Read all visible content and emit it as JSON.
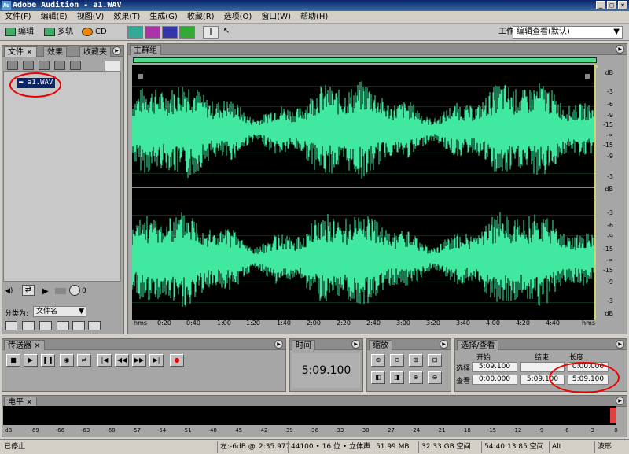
{
  "app": {
    "icon_text": "Au",
    "title": "Adobe Audition - a1.WAV"
  },
  "menu": [
    "文件(F)",
    "编辑(E)",
    "视图(V)",
    "效果(T)",
    "生成(G)",
    "收藏(R)",
    "选项(O)",
    "窗口(W)",
    "帮助(H)"
  ],
  "toolbar": {
    "edit": "编辑",
    "multitrack": "多轨",
    "cd": "CD",
    "workspace_label": "工作区:",
    "workspace_value": "编辑查看(默认)"
  },
  "files_panel": {
    "tabs": [
      "文件",
      "效果",
      "收藏夹"
    ],
    "file": "a1.WAV",
    "sort_label": "分类为:",
    "sort_value": "文件名",
    "volume": "0"
  },
  "main_panel": {
    "tab": "主群组",
    "db_unit": "dB",
    "db_labels": [
      "-3",
      "-6",
      "-9",
      "-15",
      "-∞",
      "-15",
      "-9",
      "-3"
    ],
    "timeline": [
      "hms",
      "0:20",
      "0:40",
      "1:00",
      "1:20",
      "1:40",
      "2:00",
      "2:20",
      "2:40",
      "3:00",
      "3:20",
      "3:40",
      "4:00",
      "4:20",
      "4:40",
      "hms"
    ]
  },
  "transport": {
    "tab": "传送器"
  },
  "time": {
    "tab": "时间",
    "value": "5:09.100"
  },
  "zoom": {
    "tab": "缩放"
  },
  "selection": {
    "tab": "选择/查看",
    "col_start": "开始",
    "col_end": "结束",
    "col_length": "长度",
    "row_select": "选择",
    "row_view": "查看",
    "select_start": "5:09.100",
    "select_end": "",
    "select_length": "0:00.000",
    "view_start": "0:00.000",
    "view_end": "5:09.100",
    "view_length": "5:09.100"
  },
  "levels": {
    "tab": "电平",
    "labels": [
      "dB",
      "-69",
      "-66",
      "-63",
      "-60",
      "-57",
      "-54",
      "-51",
      "-48",
      "-45",
      "-42",
      "-39",
      "-36",
      "-33",
      "-30",
      "-27",
      "-24",
      "-21",
      "-18",
      "-15",
      "-12",
      "-9",
      "-6",
      "-3",
      "0"
    ]
  },
  "status": {
    "state": "已停止",
    "peak": "左:-6dB @",
    "peak_time": "2:35.977",
    "format": "44100 • 16 位 • 立体声",
    "size": "51.99 MB",
    "free": "32.33 GB 空间",
    "free_time": "54:40:13.85 空间",
    "key": "Alt",
    "view_mode": "波形"
  },
  "colors": {
    "waveform": "#40e8a0",
    "background": "#000000",
    "accent": "#e00000"
  }
}
